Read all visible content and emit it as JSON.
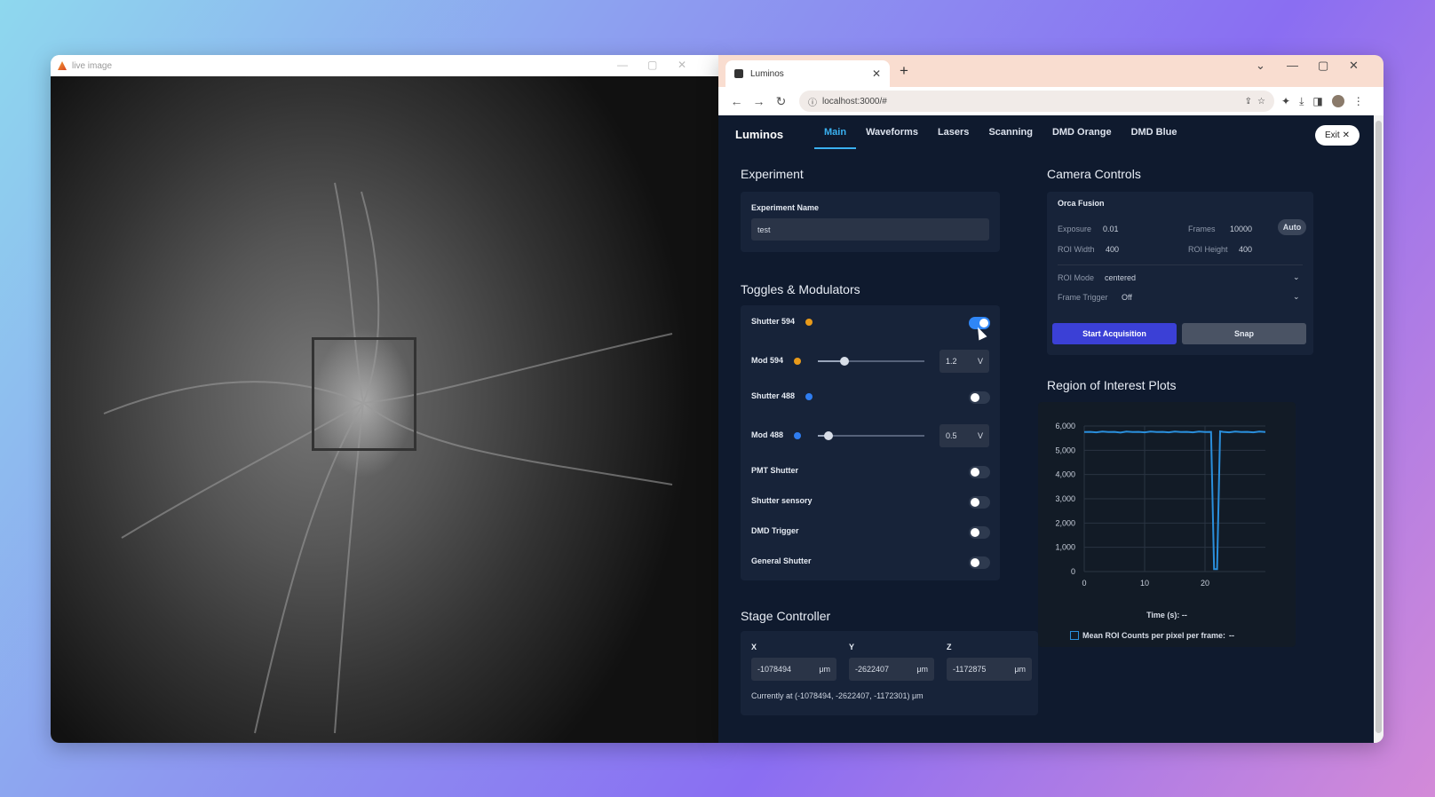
{
  "left_window": {
    "title": "live image",
    "controls": [
      "—",
      "▢",
      "✕"
    ]
  },
  "browser": {
    "tab_title": "Luminos",
    "new_tab": "+",
    "url": "localhost:3000/#",
    "window_controls": [
      "⌄",
      "—",
      "▢",
      "✕"
    ]
  },
  "app": {
    "brand": "Luminos",
    "tabs": [
      {
        "label": "Main",
        "active": true
      },
      {
        "label": "Waveforms"
      },
      {
        "label": "Lasers"
      },
      {
        "label": "Scanning"
      },
      {
        "label": "DMD Orange"
      },
      {
        "label": "DMD Blue"
      }
    ],
    "exit_label": "Exit",
    "experiment": {
      "heading": "Experiment",
      "name_label": "Experiment Name",
      "name_value": "test"
    },
    "toggles": {
      "heading": "Toggles & Modulators",
      "shutter594": {
        "label": "Shutter 594",
        "on": true,
        "color": "#e89a1a"
      },
      "mod594": {
        "label": "Mod 594",
        "value": "1.2",
        "unit": "V",
        "level": 0.25,
        "color": "#e89a1a"
      },
      "shutter488": {
        "label": "Shutter 488",
        "on": false,
        "color": "#2f7df0"
      },
      "mod488": {
        "label": "Mod 488",
        "value": "0.5",
        "unit": "V",
        "level": 0.1,
        "color": "#2f7df0"
      },
      "pmt": {
        "label": "PMT Shutter",
        "on": false
      },
      "sensory": {
        "label": "Shutter sensory",
        "on": false
      },
      "dmd": {
        "label": "DMD Trigger",
        "on": false
      },
      "general": {
        "label": "General Shutter",
        "on": false
      }
    },
    "stage": {
      "heading": "Stage Controller",
      "x_label": "X",
      "x_value": "-1078494",
      "y_label": "Y",
      "y_value": "-2622407",
      "z_label": "Z",
      "z_value": "-1172875",
      "unit": "μm",
      "status": "Currently at (-1078494, -2622407, -1172301) μm"
    },
    "camera": {
      "heading": "Camera Controls",
      "model": "Orca Fusion",
      "exposure_label": "Exposure",
      "exposure_value": "0.01",
      "frames_label": "Frames",
      "frames_value": "10000",
      "auto_label": "Auto",
      "roi_width_label": "ROI Width",
      "roi_width_value": "400",
      "roi_height_label": "ROI Height",
      "roi_height_value": "400",
      "roi_mode_label": "ROI Mode",
      "roi_mode_value": "centered",
      "frame_trigger_label": "Frame Trigger",
      "frame_trigger_value": "Off",
      "start_label": "Start Acquisition",
      "snap_label": "Snap",
      "start_color": "#3b40d6"
    },
    "roi_plots": {
      "heading": "Region of Interest Plots",
      "time_label": "Time (s):",
      "time_value": "--",
      "legend_label": "Mean ROI Counts per pixel per frame:",
      "legend_value": "--",
      "line_color": "#2a8fdc"
    }
  },
  "chart_data": {
    "type": "line",
    "x": [
      0,
      1,
      2,
      3,
      4,
      5,
      6,
      7,
      8,
      9,
      10,
      11,
      12,
      13,
      14,
      15,
      16,
      17,
      18,
      19,
      20,
      21,
      21.5,
      22,
      22.5,
      23,
      24,
      25,
      26,
      27,
      28,
      29,
      30
    ],
    "series": [
      {
        "values": [
          5750,
          5760,
          5740,
          5770,
          5750,
          5760,
          5730,
          5770,
          5750,
          5760,
          5740,
          5770,
          5750,
          5760,
          5740,
          5770,
          5750,
          5760,
          5740,
          5770,
          5750,
          5760,
          100,
          100,
          5780,
          5760,
          5740,
          5770,
          5750,
          5760,
          5740,
          5770,
          5750
        ]
      }
    ],
    "xlim": [
      0,
      30
    ],
    "ylim": [
      0,
      6000
    ],
    "x_ticks": [
      "0",
      "10",
      "20"
    ],
    "y_ticks": [
      "0",
      "1,000",
      "2,000",
      "3,000",
      "4,000",
      "5,000",
      "6,000"
    ],
    "grid": true
  }
}
